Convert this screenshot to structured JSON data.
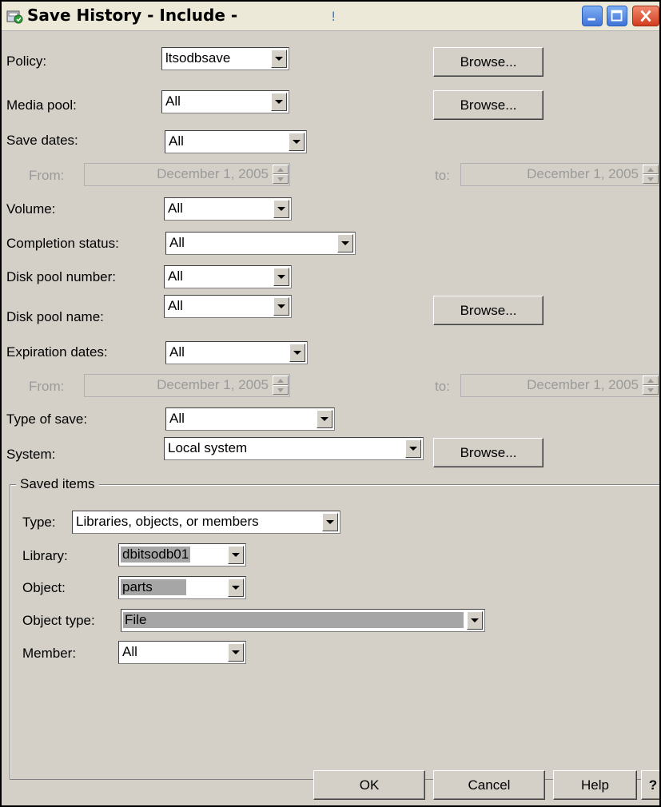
{
  "window": {
    "title": "Save History - Include -",
    "title_mark": "!",
    "icon": "save-history-icon",
    "controls": [
      "minimize-icon",
      "maximize-icon",
      "close-icon"
    ]
  },
  "fields": {
    "policy": {
      "label": "Policy:",
      "value": "ltsodbsave",
      "browse": "Browse..."
    },
    "media_pool": {
      "label": "Media pool:",
      "value": "All",
      "browse": "Browse..."
    },
    "save_dates": {
      "label": "Save dates:",
      "value": "All"
    },
    "save_from": {
      "label": "From:",
      "value": "December 1, 2005"
    },
    "save_to": {
      "label": "to:",
      "value": "December 1, 2005"
    },
    "volume": {
      "label": "Volume:",
      "value": "All"
    },
    "completion_status": {
      "label": "Completion status:",
      "value": "All"
    },
    "disk_pool_number": {
      "label": "Disk pool number:",
      "value": "All"
    },
    "disk_pool_name": {
      "label": "Disk pool name:",
      "value": "All",
      "browse": "Browse..."
    },
    "expiration_dates": {
      "label": "Expiration dates:",
      "value": "All"
    },
    "exp_from": {
      "label": "From:",
      "value": "December 1, 2005"
    },
    "exp_to": {
      "label": "to:",
      "value": "December 1, 2005"
    },
    "type_of_save": {
      "label": "Type of save:",
      "value": "All"
    },
    "system": {
      "label": "System:",
      "value": "Local system",
      "browse": "Browse..."
    }
  },
  "saved_items": {
    "title": "Saved items",
    "type": {
      "label": "Type:",
      "value": "Libraries, objects, or members"
    },
    "library": {
      "label": "Library:",
      "value": "dbitsodb01"
    },
    "object": {
      "label": "Object:",
      "value": "parts"
    },
    "object_type": {
      "label": "Object type:",
      "value": "File"
    },
    "member": {
      "label": "Member:",
      "value": "All"
    }
  },
  "buttons": {
    "ok": "OK",
    "cancel": "Cancel",
    "help": "Help",
    "whats_this": "?"
  },
  "colors": {
    "window_bg": "#d4d0c8",
    "titlebar_bg": "#ece9d8",
    "highlight_bg": "#a6a6a6",
    "disabled_text": "#9a9a9a"
  }
}
